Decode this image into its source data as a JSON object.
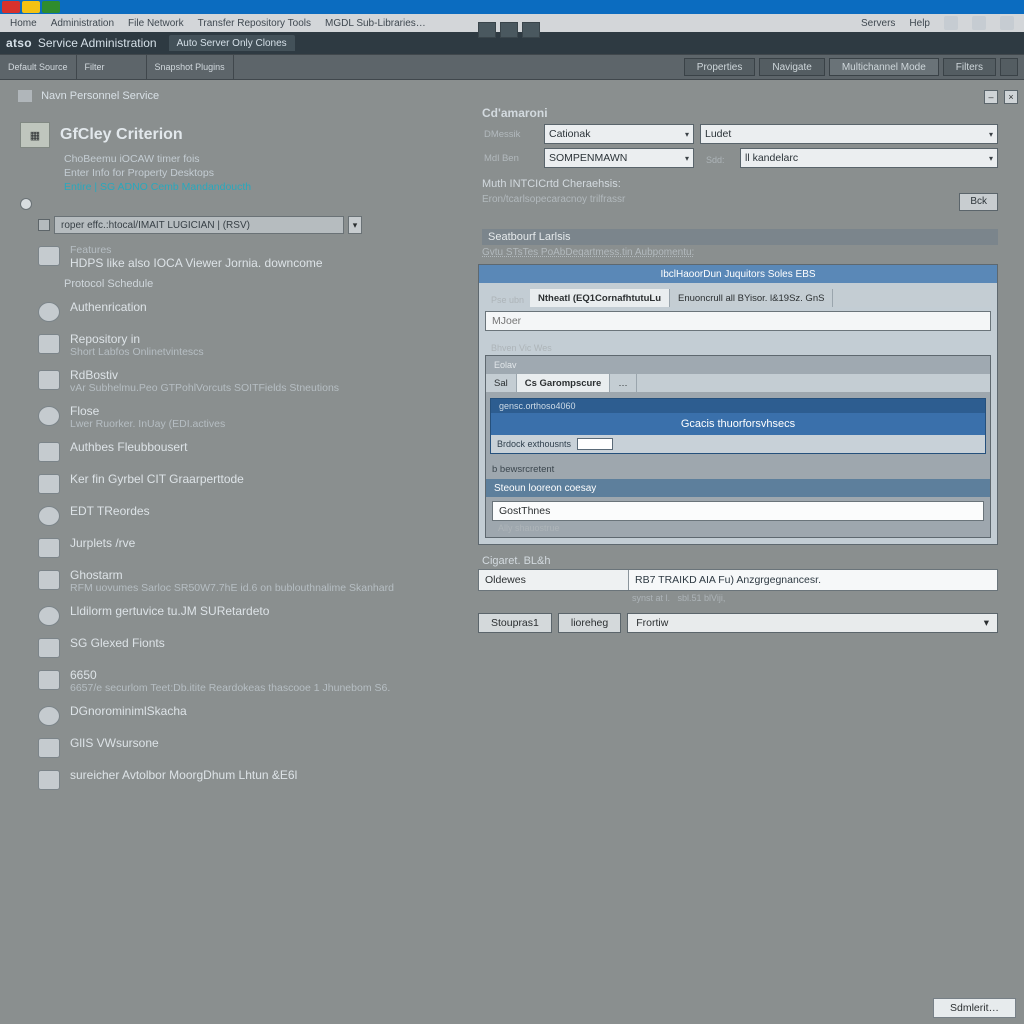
{
  "menubar": {
    "items": [
      "Home",
      "Administration",
      "File Network",
      "Transfer Repository Tools",
      "MGDL Sub-Libraries…"
    ],
    "rightItems": [
      "Servers",
      "Help"
    ]
  },
  "titlebar": {
    "brand": "atso",
    "subtitle": "Service Administration",
    "tab": "Auto Server Only Clones"
  },
  "ribbon": {
    "slots": [
      "Default\nSource",
      "Filter",
      "Snapshot\nPlugins"
    ],
    "buttons": [
      "Properties",
      "Navigate",
      "Multichannel Mode",
      "Filters"
    ]
  },
  "breadcrumb": "Navn Personnel Service",
  "left": {
    "title": "GfCley Criterion",
    "desc1": "ChoBeemu iOCAW timer fois",
    "desc2": "Enter Info for Property Desktops",
    "desc3_hl": "Entire | SG ADNO Cemb Mandandoucth",
    "searchValue": "roper effc.:htocal/IMAIT LUGICIAN | (RSV)",
    "feature_head": "Features",
    "feature_line": "HDPS like also IOCA Viewer Jornia.   downcome",
    "schedule_head": "Protocol Schedule",
    "items": [
      {
        "name": "auth-item",
        "title": "Authenrication"
      },
      {
        "name": "repository-item",
        "title": "Repository in",
        "sub": "Short Labfos  Onlinetvintescs"
      },
      {
        "name": "rdbostiv-item",
        "title": "RdBostiv",
        "sub": "vAr Subhelmu.Peo  GTPohlVorcuts SOITFields  Stneutions"
      },
      {
        "name": "flose-item",
        "title": "Flose",
        "sub": "Lwer Ruorker. InUay (EDI.actives"
      },
      {
        "name": "auth-fb-item",
        "title": "Authbes Fleubbousert"
      },
      {
        "name": "kerfin-item",
        "title": "Ker fin Gyrbel CIT Graarperttode"
      },
      {
        "name": "eot-item",
        "title": "EDT TReordes"
      },
      {
        "name": "jarplet-item",
        "title": "Jurplets /rve"
      },
      {
        "name": "ghostarm-item",
        "title": "Ghostarm",
        "sub": "RFM uovumes Sarloc  SR50W7.7hE  id.6\non bublouthnalime Skanhard"
      },
      {
        "name": "ldd-item",
        "title": "Lldilorm gertuvice tu.JM SURetardeto"
      },
      {
        "name": "shared-fonts-item",
        "title": "SG Glexed Fionts"
      },
      {
        "name": "6650-item",
        "title": "6650",
        "sub": "6657/e   securlom   Teet:Db.itite Reardokeas   thascooe 1\nJhunebom S6.  "
      },
      {
        "name": "docron-item",
        "title": "DGnorominimlSkacha"
      },
      {
        "name": "viswerse-item",
        "title": "GlIS VWsursone"
      },
      {
        "name": "sureicher-item",
        "title": "sureicher Avtolbor MoorgDhum Lhtun &E6l"
      }
    ]
  },
  "right": {
    "heading": "Cd'amaroni",
    "pathLine_label": "DMessik",
    "pathLine_value": "Cationak",
    "pathLine2_value": "Ludet",
    "mdlben_label": "Mdl Ben",
    "mdlben_value": "SOMPENMAWN",
    "mdlben_side": "ll   kandelarc",
    "characters_label": "Muth INTCICrtd Cheraehsis:",
    "characters_hint": "Eron/tcarlsopecaracnoy trilfrassr",
    "bck_button": "Bck",
    "searchui_head": "Seatbourf Larlsis",
    "searchui_sub": "Gvtu STsTes PoAbDeqartmess.tin  Aubpomentu:",
    "dash_title": "IbclHaoorDun Juquitors Soles EBS",
    "pse_label": "Pse ubn",
    "mixer_placeholder": "MJoer",
    "tab_a": "Ntheatl (EQ1CornafhtutuLu",
    "tab_b": "Enuoncrull all BYisor. l&19Sz. GnS",
    "bones_head": "Bhven  Vic Wes",
    "bailey_label": "Eolav",
    "cs_tab": "Cs  Garompscure",
    "inner_title": "Gcacis thuorforsvhsecs",
    "section_head": "Steoun looreon coesay",
    "gosttunes": "GostThnes",
    "sub2": "Ally shauostrue",
    "cigaret_head": "Cigaret. BL&h",
    "split_left": "Oldewes",
    "split_right": "RB7 TRAIKD AIA Fu) Anzgrgegnancesr.",
    "btn_suppress": "Stoupras1",
    "btn_derbos": "lioreheg",
    "drop_other": "Frortiw"
  },
  "footer_button": "Sdmlerit…"
}
